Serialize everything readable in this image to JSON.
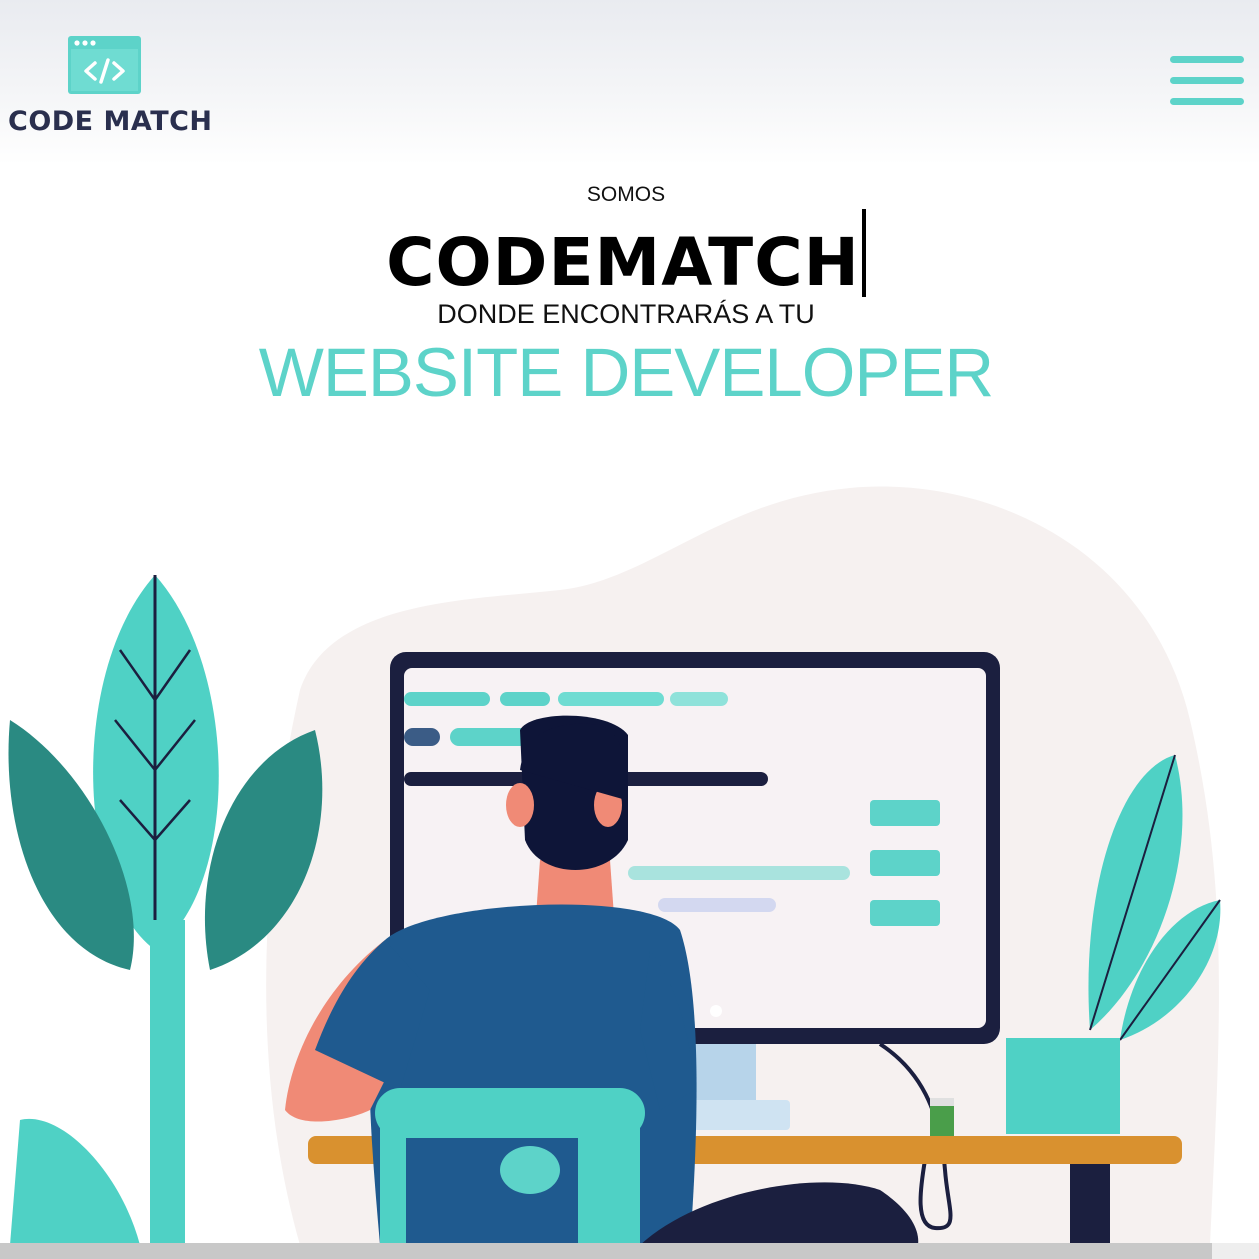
{
  "brand": {
    "name": "CODE MATCH",
    "icon": "code-window-icon",
    "color": "#5dd3c9"
  },
  "nav": {
    "menu_icon": "hamburger-menu-icon"
  },
  "hero": {
    "kicker": "SOMOS",
    "title": "CODEMATCH",
    "subtitle": "DONDE ENCONTRARÁS A TU",
    "accent": "WEBSITE DEVELOPER"
  },
  "illustration": {
    "subject": "developer-at-desk-illustration"
  },
  "colors": {
    "accent": "#5dd3c9",
    "dark_text": "#2a2f4e",
    "shirt": "#1f5a8f",
    "monitor": "#1b1f3f"
  }
}
